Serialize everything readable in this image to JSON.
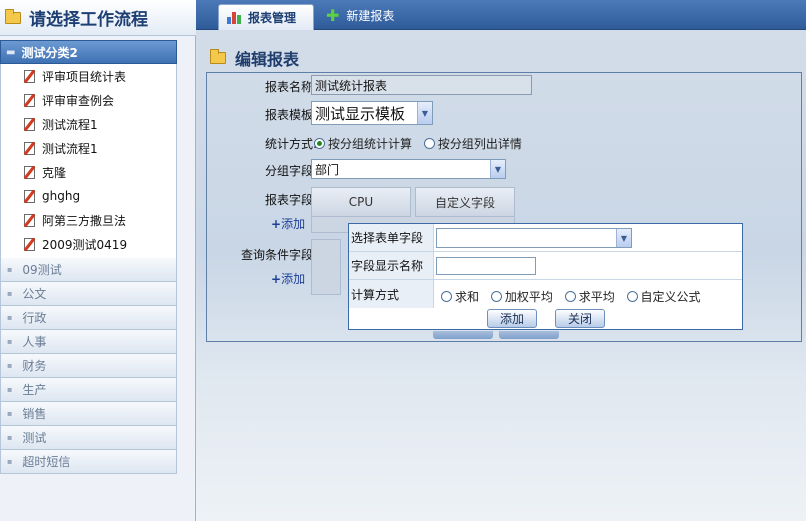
{
  "sidebar": {
    "title": "请选择工作流程",
    "active_group": "测试分类2",
    "items": [
      {
        "label": "评审项目统计表"
      },
      {
        "label": "评审审查例会"
      },
      {
        "label": "测试流程1"
      },
      {
        "label": "测试流程1"
      },
      {
        "label": "克隆"
      },
      {
        "label": "ghghg"
      },
      {
        "label": "阿第三方撒旦法"
      },
      {
        "label": "2009测试0419"
      }
    ],
    "categories": [
      {
        "label": "09测试"
      },
      {
        "label": "公文"
      },
      {
        "label": "行政"
      },
      {
        "label": "人事"
      },
      {
        "label": "财务"
      },
      {
        "label": "生产"
      },
      {
        "label": "销售"
      },
      {
        "label": "测试"
      },
      {
        "label": "超时短信"
      }
    ]
  },
  "tabs": {
    "report_management": "报表管理",
    "new_report": "新建报表"
  },
  "form": {
    "section_title": "编辑报表",
    "name_label": "报表名称:",
    "name_value": "测试统计报表",
    "template_label": "报表模板:",
    "template_value": "测试显示模板",
    "method_label": "统计方式:",
    "method_option1": "按分组统计计算",
    "method_option2": "按分组列出详情",
    "group_label": "分组字段:",
    "group_value": "部门",
    "fields_label": "报表字段:",
    "field_tabs": [
      "CPU",
      "自定义字段"
    ],
    "add_label": "添加",
    "query_label": "查询条件字段:",
    "add_label2": "添加"
  },
  "dialog": {
    "select_field_label": "选择表单字段",
    "display_name_label": "字段显示名称",
    "calc_label": "计算方式",
    "options": [
      "求和",
      "加权平均",
      "求平均",
      "自定义公式"
    ],
    "add_button": "添加",
    "close_button": "关闭"
  },
  "colors": {
    "accent": "#3f72b4",
    "topbar": "#2f5b99"
  }
}
